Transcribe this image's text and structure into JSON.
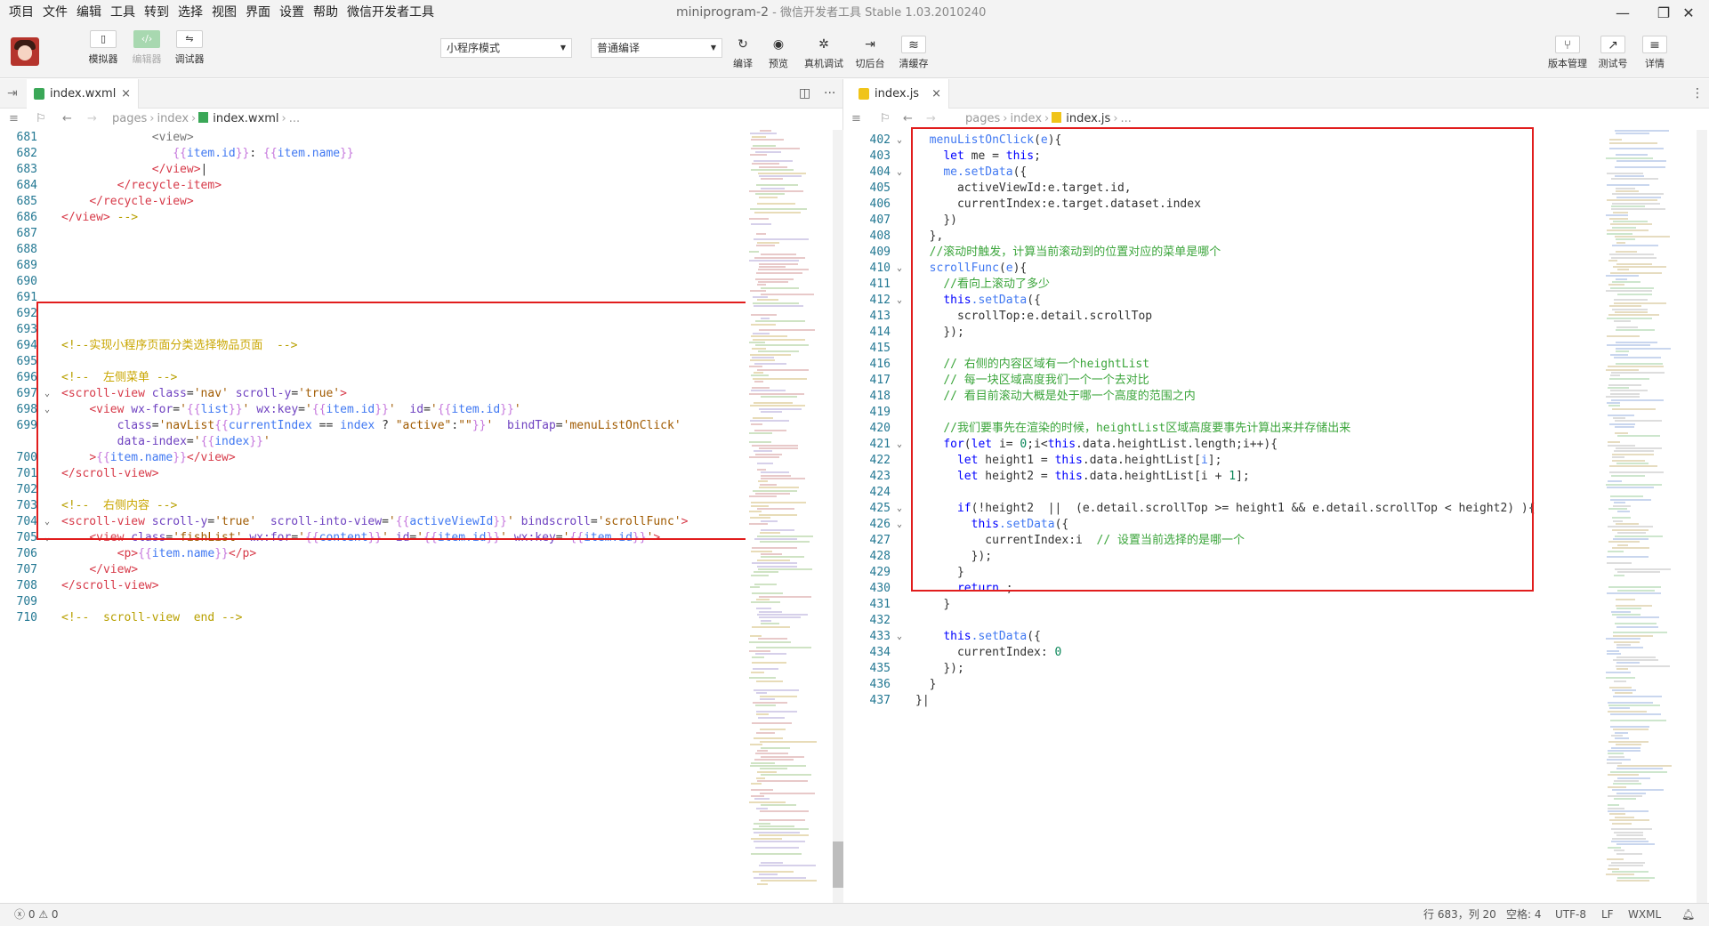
{
  "menu": [
    "项目",
    "文件",
    "编辑",
    "工具",
    "转到",
    "选择",
    "视图",
    "界面",
    "设置",
    "帮助",
    "微信开发者工具"
  ],
  "window": {
    "project": "miniprogram-2",
    "title": "- 微信开发者工具 Stable 1.03.2010240"
  },
  "toolbar": {
    "left_buttons": [
      {
        "label": "模拟器",
        "icon": "phone-icon",
        "glyph": "▯"
      },
      {
        "label": "编辑器",
        "icon": "code-icon",
        "glyph": "‹/›"
      },
      {
        "label": "调试器",
        "icon": "debug-icon",
        "glyph": "⇋"
      }
    ],
    "mode_select": "小程序模式",
    "compile_select": "普通编译",
    "center_buttons": [
      {
        "label": "编译",
        "icon": "refresh-icon",
        "glyph": "↻"
      },
      {
        "label": "预览",
        "icon": "eye-icon",
        "glyph": "◉"
      },
      {
        "label": "真机调试",
        "icon": "bug-icon",
        "glyph": "✲"
      },
      {
        "label": "切后台",
        "icon": "switch-icon",
        "glyph": "⇥"
      },
      {
        "label": "清缓存",
        "icon": "layers-icon",
        "glyph": "≋"
      }
    ],
    "right_buttons": [
      {
        "label": "版本管理",
        "icon": "branch-icon",
        "glyph": "⑂"
      },
      {
        "label": "测试号",
        "icon": "external-link-icon",
        "glyph": "↗"
      },
      {
        "label": "详情",
        "icon": "menu-icon",
        "glyph": "≡"
      }
    ]
  },
  "left_editor": {
    "tab": "index.wxml",
    "tab_close": "×",
    "crumbs": [
      "pages",
      "index",
      "index.wxml",
      "..."
    ],
    "lines": [
      {
        "n": "681",
        "fold": "",
        "indent": "",
        "html": "<span class=\"t-gray\">             &lt;view&gt;</span>"
      },
      {
        "n": "682",
        "fold": "",
        "html": "                <span class=\"t-mus\">{{</span><span class=\"t-var\">item.id</span><span class=\"t-mus\">}}</span><span class=\"t-plain\">: </span><span class=\"t-mus\">{{</span><span class=\"t-var\">item.name</span><span class=\"t-mus\">}}</span>"
      },
      {
        "n": "683",
        "fold": "",
        "html": "             <span class=\"t-tag\">&lt;/view&gt;</span><span class=\"t-plain\">|</span>"
      },
      {
        "n": "684",
        "fold": "",
        "html": "        <span class=\"t-tag\">&lt;/recycle-item&gt;</span>"
      },
      {
        "n": "685",
        "fold": "",
        "html": "    <span class=\"t-tag\">&lt;/recycle-view&gt;</span>"
      },
      {
        "n": "686",
        "fold": "",
        "html": "<span class=\"t-tag\">&lt;/view&gt;</span> <span class=\"t-com\">--&gt;</span>"
      },
      {
        "n": "687",
        "fold": "",
        "html": ""
      },
      {
        "n": "688",
        "fold": "",
        "html": ""
      },
      {
        "n": "689",
        "fold": "",
        "html": ""
      },
      {
        "n": "690",
        "fold": "",
        "html": ""
      },
      {
        "n": "691",
        "fold": "",
        "html": ""
      },
      {
        "n": "692",
        "fold": "",
        "html": ""
      },
      {
        "n": "693",
        "fold": "",
        "html": ""
      },
      {
        "n": "694",
        "fold": "",
        "html": "<span class=\"t-com\">&lt;!--</span><span class=\"t-com-cn\">实现小程序页面分类选择物品页面</span>  <span class=\"t-com\">--&gt;</span>"
      },
      {
        "n": "695",
        "fold": "",
        "html": ""
      },
      {
        "n": "696",
        "fold": "",
        "html": "<span class=\"t-com\">&lt;!--</span>  <span class=\"t-com-cn\">左侧菜单</span> <span class=\"t-com\">--&gt;</span>"
      },
      {
        "n": "697",
        "fold": "⌄",
        "html": "<span class=\"t-tag\">&lt;scroll-view</span> <span class=\"t-attr\">class</span><span class=\"t-plain\">=</span><span class=\"t-str\">'nav'</span> <span class=\"t-attr\">scroll-y</span><span class=\"t-plain\">=</span><span class=\"t-str\">'true'</span><span class=\"t-tag\">&gt;</span>"
      },
      {
        "n": "698",
        "fold": "⌄",
        "html": "    <span class=\"t-tag\">&lt;view</span> <span class=\"t-attr\">wx-for</span><span class=\"t-plain\">=</span><span class=\"t-str\">'</span><span class=\"t-mus\">{{</span><span class=\"t-var\">list</span><span class=\"t-mus\">}}</span><span class=\"t-str\">'</span> <span class=\"t-attr\">wx:key</span><span class=\"t-plain\">=</span><span class=\"t-str\">'</span><span class=\"t-mus\">{{</span><span class=\"t-var\">item.id</span><span class=\"t-mus\">}}</span><span class=\"t-str\">'</span>  <span class=\"t-attr\">id</span><span class=\"t-plain\">=</span><span class=\"t-str\">'</span><span class=\"t-mus\">{{</span><span class=\"t-var\">item.id</span><span class=\"t-mus\">}}</span><span class=\"t-str\">'</span>"
      },
      {
        "n": "699",
        "fold": "",
        "html": "        <span class=\"t-attr\">class</span><span class=\"t-plain\">=</span><span class=\"t-str\">'navList</span><span class=\"t-mus\">{{</span><span class=\"t-var\">currentIndex</span> <span class=\"t-plain\">==</span> <span class=\"t-var\">index</span> <span class=\"t-plain\">?</span> <span class=\"t-str\">\"active\"</span><span class=\"t-plain\">:</span><span class=\"t-str\">\"\"</span><span class=\"t-mus\">}}</span><span class=\"t-str\">'</span>  <span class=\"t-attr\">bindTap</span><span class=\"t-plain\">=</span><span class=\"t-str\">'menuListOnClick'</span>"
      },
      {
        "n": "",
        "fold": "",
        "html": "        <span class=\"t-attr\">data-index</span><span class=\"t-plain\">=</span><span class=\"t-str\">'</span><span class=\"t-mus\">{{</span><span class=\"t-var\">index</span><span class=\"t-mus\">}}</span><span class=\"t-str\">'</span>"
      },
      {
        "n": "700",
        "fold": "",
        "html": "    <span class=\"t-tag\">&gt;</span><span class=\"t-mus\">{{</span><span class=\"t-var\">item.name</span><span class=\"t-mus\">}}</span><span class=\"t-tag\">&lt;/view&gt;</span>"
      },
      {
        "n": "701",
        "fold": "",
        "html": "<span class=\"t-tag\">&lt;/scroll-view&gt;</span>"
      },
      {
        "n": "702",
        "fold": "",
        "html": ""
      },
      {
        "n": "703",
        "fold": "",
        "html": "<span class=\"t-com\">&lt;!--</span>  <span class=\"t-com-cn\">右侧内容</span> <span class=\"t-com\">--&gt;</span>"
      },
      {
        "n": "704",
        "fold": "⌄",
        "html": "<span class=\"t-tag\">&lt;scroll-view</span> <span class=\"t-attr\">scroll-y</span><span class=\"t-plain\">=</span><span class=\"t-str\">'true'</span>  <span class=\"t-attr\">scroll-into-view</span><span class=\"t-plain\">=</span><span class=\"t-str\">'</span><span class=\"t-mus\">{{</span><span class=\"t-var\">activeViewId</span><span class=\"t-mus\">}}</span><span class=\"t-str\">'</span> <span class=\"t-attr\">bindscroll</span><span class=\"t-plain\">=</span><span class=\"t-str\">'scrollFunc'</span><span class=\"t-tag\">&gt;</span>"
      },
      {
        "n": "705",
        "fold": "⌄",
        "html": "    <span class=\"t-tag\">&lt;view</span> <span class=\"t-attr\">class</span><span class=\"t-plain\">=</span><span class=\"t-str\">'fishList'</span> <span class=\"t-attr\">wx:for</span><span class=\"t-plain\">=</span><span class=\"t-str\">'</span><span class=\"t-mus\">{{</span><span class=\"t-var\">content</span><span class=\"t-mus\">}}</span><span class=\"t-str\">'</span> <span class=\"t-attr\">id</span><span class=\"t-plain\">=</span><span class=\"t-str\">'</span><span class=\"t-mus\">{{</span><span class=\"t-var\">item.id</span><span class=\"t-mus\">}}</span><span class=\"t-str\">'</span> <span class=\"t-attr\">wx:key</span><span class=\"t-plain\">=</span><span class=\"t-str\">'</span><span class=\"t-mus\">{{</span><span class=\"t-var\">item.id</span><span class=\"t-mus\">}}</span><span class=\"t-str\">'</span><span class=\"t-tag\">&gt;</span>"
      },
      {
        "n": "706",
        "fold": "",
        "html": "        <span class=\"t-tag\">&lt;p&gt;</span><span class=\"t-mus\">{{</span><span class=\"t-var\">item.name</span><span class=\"t-mus\">}}</span><span class=\"t-tag\">&lt;/p&gt;</span>"
      },
      {
        "n": "707",
        "fold": "",
        "html": "    <span class=\"t-tag\">&lt;/view&gt;</span>"
      },
      {
        "n": "708",
        "fold": "",
        "html": "<span class=\"t-tag\">&lt;/scroll-view&gt;</span>"
      },
      {
        "n": "709",
        "fold": "",
        "html": ""
      },
      {
        "n": "710",
        "fold": "",
        "html": "<span class=\"t-com\">&lt;!--</span>  <span class=\"t-com\">scroll-view  end</span> <span class=\"t-com\">--&gt;</span>"
      }
    ]
  },
  "right_editor": {
    "tab": "index.js",
    "tab_close": "×",
    "crumbs": [
      "pages",
      "index",
      "index.js",
      "..."
    ],
    "lines": [
      {
        "n": "402",
        "fold": "⌄",
        "html": "  <span class=\"t-fn\">menuListOnClick</span><span class=\"t-plain\">(</span><span class=\"t-var\">e</span><span class=\"t-plain\">){</span>"
      },
      {
        "n": "403",
        "fold": "",
        "html": "    <span class=\"t-kw\">let</span> <span class=\"t-plain\">me =</span> <span class=\"t-kw\">this</span><span class=\"t-plain\">;</span>"
      },
      {
        "n": "404",
        "fold": "⌄",
        "html": "    <span class=\"t-fn\">me.setData</span><span class=\"t-plain\">({</span>"
      },
      {
        "n": "405",
        "fold": "",
        "html": "      <span class=\"t-plain\">activeViewId:e.target.id,</span>"
      },
      {
        "n": "406",
        "fold": "",
        "html": "      <span class=\"t-plain\">currentIndex:e.target.dataset.index</span>"
      },
      {
        "n": "407",
        "fold": "",
        "html": "    <span class=\"t-plain\">})</span>"
      },
      {
        "n": "408",
        "fold": "",
        "html": "  <span class=\"t-plain\">},</span>"
      },
      {
        "n": "409",
        "fold": "",
        "html": "  <span class=\"t-comjs\">//滚动时触发，计算当前滚动到的位置对应的菜单是哪个</span>"
      },
      {
        "n": "410",
        "fold": "⌄",
        "html": "  <span class=\"t-fn\">scrollFunc</span><span class=\"t-plain\">(</span><span class=\"t-var\">e</span><span class=\"t-plain\">){</span>"
      },
      {
        "n": "411",
        "fold": "",
        "html": "    <span class=\"t-comjs\">//看向上滚动了多少</span>"
      },
      {
        "n": "412",
        "fold": "⌄",
        "html": "    <span class=\"t-kw\">this</span><span class=\"t-fn\">.setData</span><span class=\"t-plain\">({</span>"
      },
      {
        "n": "413",
        "fold": "",
        "html": "      <span class=\"t-plain\">scrollTop:e.detail.scrollTop</span>"
      },
      {
        "n": "414",
        "fold": "",
        "html": "    <span class=\"t-plain\">});</span>"
      },
      {
        "n": "415",
        "fold": "",
        "html": ""
      },
      {
        "n": "416",
        "fold": "",
        "html": "    <span class=\"t-comjs\">// 右侧的内容区域有一个heightList</span>"
      },
      {
        "n": "417",
        "fold": "",
        "html": "    <span class=\"t-comjs\">// 每一块区域高度我们一个一个去对比</span>"
      },
      {
        "n": "418",
        "fold": "",
        "html": "    <span class=\"t-comjs\">// 看目前滚动大概是处于哪一个高度的范围之内</span>"
      },
      {
        "n": "419",
        "fold": "",
        "html": ""
      },
      {
        "n": "420",
        "fold": "",
        "html": "    <span class=\"t-comjs\">//我们要事先在渲染的时候，heightList区域高度要事先计算出来并存储出来</span>"
      },
      {
        "n": "421",
        "fold": "⌄",
        "html": "    <span class=\"t-kw\">for</span><span class=\"t-plain\">(</span><span class=\"t-kw\">let</span> <span class=\"t-plain\">i=</span> <span class=\"t-num\">0</span><span class=\"t-plain\">;i&lt;</span><span class=\"t-kw\">this</span><span class=\"t-plain\">.data.heightList.length;i++){</span>"
      },
      {
        "n": "422",
        "fold": "",
        "html": "      <span class=\"t-kw\">let</span> <span class=\"t-plain\">height1 =</span> <span class=\"t-kw\">this</span><span class=\"t-plain\">.data.heightList[</span><span class=\"t-var\">i</span><span class=\"t-plain\">];</span>"
      },
      {
        "n": "423",
        "fold": "",
        "html": "      <span class=\"t-kw\">let</span> <span class=\"t-plain\">height2 =</span> <span class=\"t-kw\">this</span><span class=\"t-plain\">.data.heightList[i +</span> <span class=\"t-num\">1</span><span class=\"t-plain\">];</span>"
      },
      {
        "n": "424",
        "fold": "",
        "html": ""
      },
      {
        "n": "425",
        "fold": "⌄",
        "html": "      <span class=\"t-kw\">if</span><span class=\"t-plain\">(!height2  ||  (e.detail.scrollTop &gt;= height1 &amp;&amp; e.detail.scrollTop &lt; height2) ){</span>"
      },
      {
        "n": "426",
        "fold": "⌄",
        "html": "        <span class=\"t-kw\">this</span><span class=\"t-fn\">.setData</span><span class=\"t-plain\">({</span>"
      },
      {
        "n": "427",
        "fold": "",
        "html": "          <span class=\"t-plain\">currentIndex:i</span>  <span class=\"t-comjs\">// 设置当前选择的是哪一个</span>"
      },
      {
        "n": "428",
        "fold": "",
        "html": "        <span class=\"t-plain\">});</span>"
      },
      {
        "n": "429",
        "fold": "",
        "html": "      <span class=\"t-plain\">}</span>"
      },
      {
        "n": "430",
        "fold": "",
        "html": "      <span class=\"t-kw\">return</span> <span class=\"t-plain\">;</span>"
      },
      {
        "n": "431",
        "fold": "",
        "html": "    <span class=\"t-plain\">}</span>"
      },
      {
        "n": "432",
        "fold": "",
        "html": ""
      },
      {
        "n": "433",
        "fold": "⌄",
        "html": "    <span class=\"t-kw\">this</span><span class=\"t-fn\">.setData</span><span class=\"t-plain\">({</span>"
      },
      {
        "n": "434",
        "fold": "",
        "html": "      <span class=\"t-plain\">currentIndex:</span> <span class=\"t-num\">0</span>"
      },
      {
        "n": "435",
        "fold": "",
        "html": "    <span class=\"t-plain\">});</span>"
      },
      {
        "n": "436",
        "fold": "",
        "html": "  <span class=\"t-plain\">}</span>"
      },
      {
        "n": "437",
        "fold": "",
        "html": "<span class=\"t-plain\">}|</span>"
      }
    ]
  },
  "status": {
    "errors": "0",
    "warnings": "0",
    "position": "行 683，列 20",
    "spaces": "空格: 4",
    "encoding": "UTF-8",
    "eol": "LF",
    "language": "WXML"
  },
  "colors": {
    "highlight_box": "#e11d1d",
    "editor_active": "#a8d8b0"
  }
}
